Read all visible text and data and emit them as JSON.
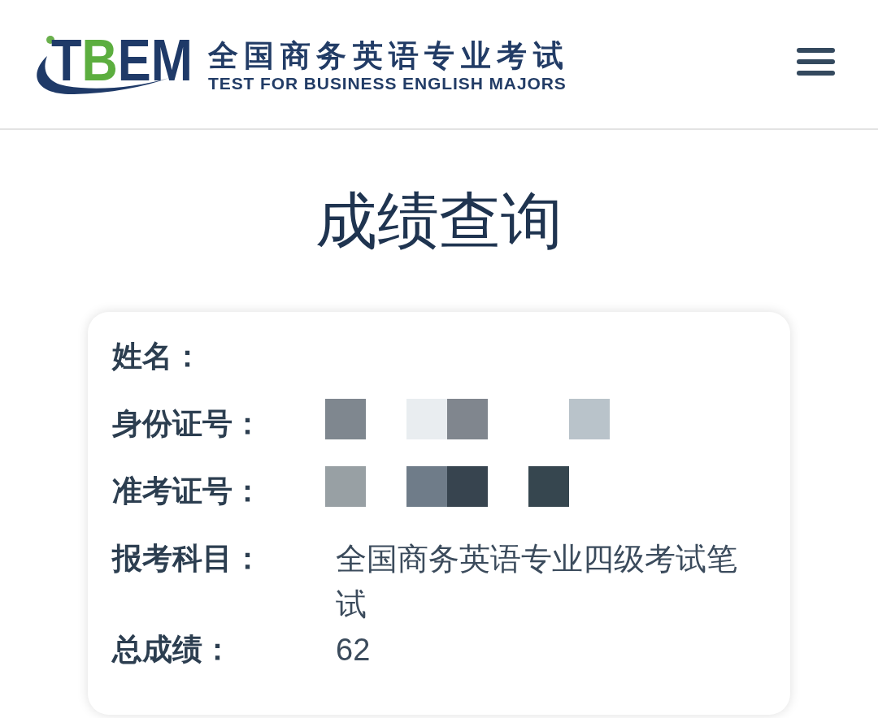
{
  "header": {
    "logo": {
      "text": "TBEM"
    },
    "site_title": "全国商务英语专业考试",
    "site_subtitle": "TEST FOR BUSINESS ENGLISH MAJORS"
  },
  "page_title": "成绩查询",
  "result_card": {
    "rows": [
      {
        "label": "姓名："
      },
      {
        "label": "身份证号：",
        "mosaic": [
          {
            "kind": "tile",
            "color": "#7f878f"
          },
          {
            "kind": "gap"
          },
          {
            "kind": "tile",
            "color": "#e9edf0"
          },
          {
            "kind": "tile",
            "color": "#80868e"
          },
          {
            "kind": "gap"
          },
          {
            "kind": "gap"
          },
          {
            "kind": "tile",
            "color": "#b9c3ca"
          }
        ]
      },
      {
        "label": "准考证号：",
        "mosaic": [
          {
            "kind": "tile",
            "color": "#98a0a4"
          },
          {
            "kind": "gap"
          },
          {
            "kind": "tile",
            "color": "#6f7c89"
          },
          {
            "kind": "tile",
            "color": "#37444f"
          },
          {
            "kind": "gap"
          },
          {
            "kind": "tile",
            "color": "#36464f"
          }
        ]
      },
      {
        "label": "报考科目：",
        "value": "全国商务英语专业四级考试笔试"
      },
      {
        "label": "总成绩：",
        "value": "62"
      }
    ]
  }
}
